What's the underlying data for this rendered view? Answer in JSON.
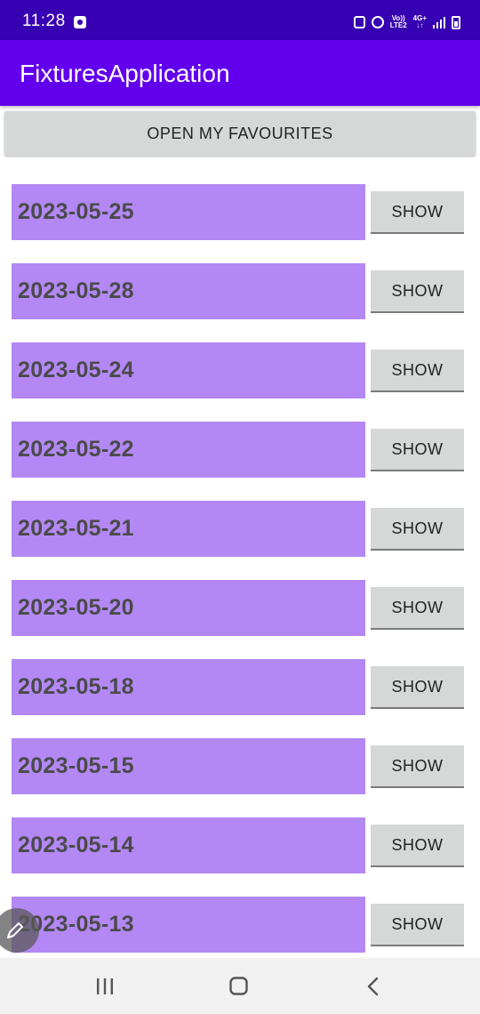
{
  "status_bar": {
    "time": "11:28",
    "network_top": "Vo))",
    "network_bottom": "LTE2",
    "data_top": "4G+",
    "data_bottom": "↓↑"
  },
  "app_bar": {
    "title": "FixturesApplication"
  },
  "favourites_button": {
    "label": "OPEN MY FAVOURITES"
  },
  "fixtures": [
    {
      "date": "2023-05-25",
      "button": "SHOW"
    },
    {
      "date": "2023-05-28",
      "button": "SHOW"
    },
    {
      "date": "2023-05-24",
      "button": "SHOW"
    },
    {
      "date": "2023-05-22",
      "button": "SHOW"
    },
    {
      "date": "2023-05-21",
      "button": "SHOW"
    },
    {
      "date": "2023-05-20",
      "button": "SHOW"
    },
    {
      "date": "2023-05-18",
      "button": "SHOW"
    },
    {
      "date": "2023-05-15",
      "button": "SHOW"
    },
    {
      "date": "2023-05-14",
      "button": "SHOW"
    },
    {
      "date": "2023-05-13",
      "button": "SHOW"
    }
  ],
  "colors": {
    "status_bar": "#3700b3",
    "app_bar": "#6200ee",
    "date_background": "#b388f5",
    "button_background": "#d6d7d7"
  },
  "icons": {
    "status_notification": "app-notification-icon",
    "status_left": "sync-icon",
    "status_alarm": "alarm-icon",
    "status_signal": "signal-icon",
    "status_battery": "battery-charging-icon",
    "floating_action": "pencil-icon",
    "nav_recents": "recents-icon",
    "nav_home": "home-icon",
    "nav_back": "back-icon"
  }
}
